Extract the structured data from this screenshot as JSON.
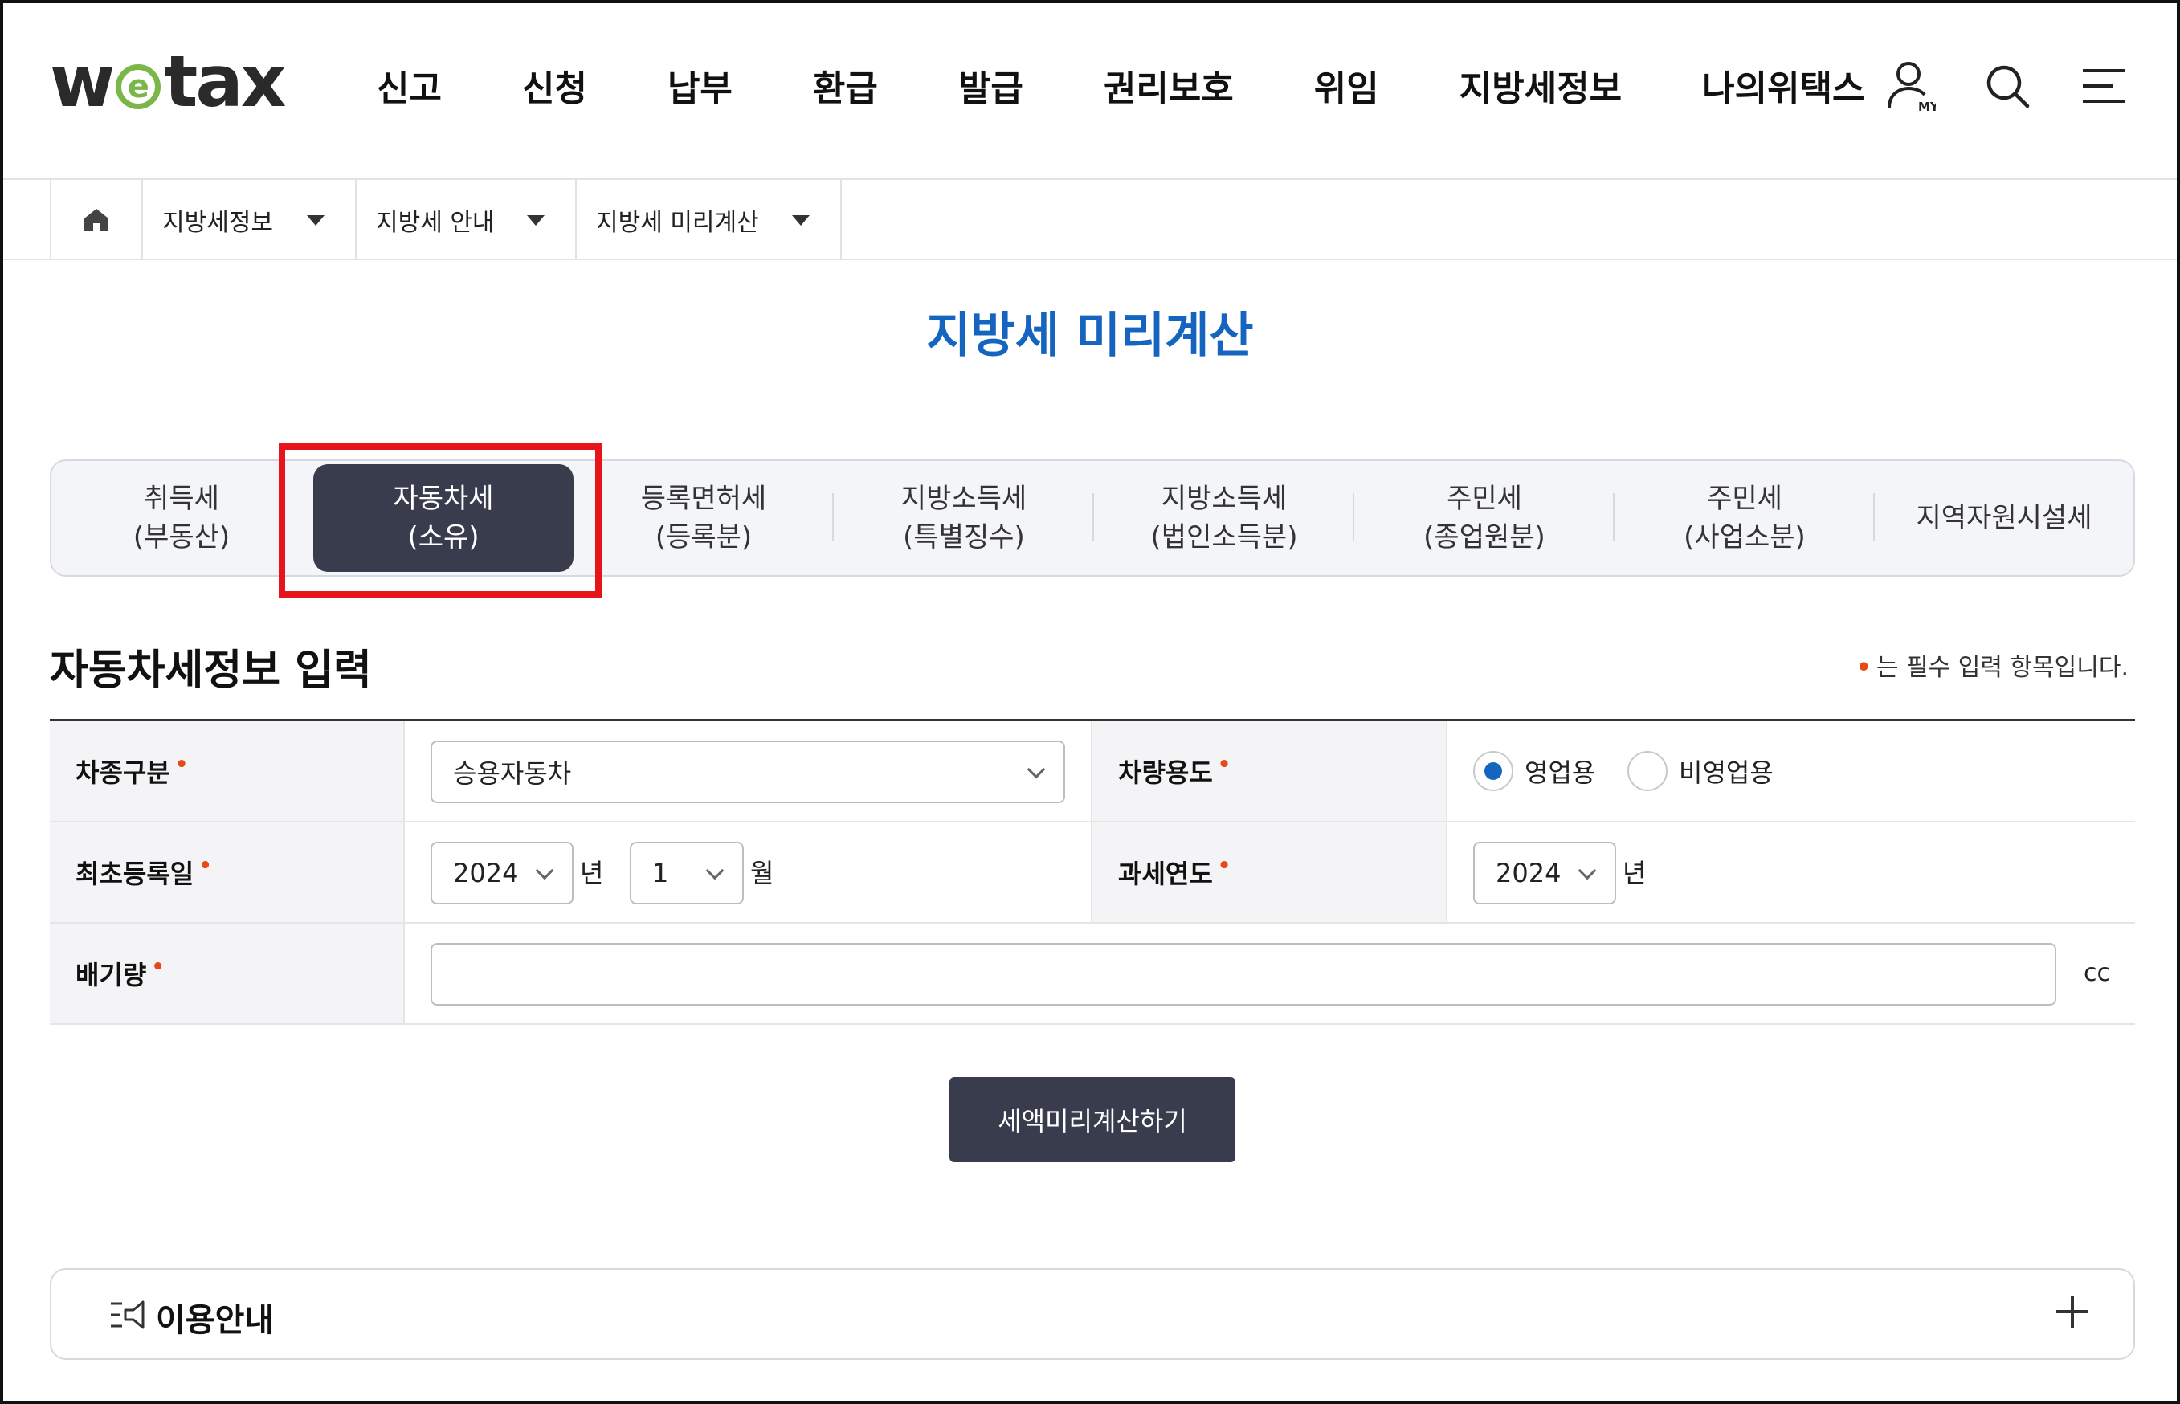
{
  "header": {
    "logo_pre": "w",
    "logo_e": "e",
    "logo_post": "tax",
    "nav": [
      "신고",
      "신청",
      "납부",
      "환급",
      "발급",
      "권리보호",
      "위임",
      "지방세정보",
      "나의위택스"
    ],
    "icons": [
      "my-user-icon",
      "search-icon",
      "menu-icon"
    ],
    "my_badge": "MY"
  },
  "breadcrumb": {
    "items": [
      "지방세정보",
      "지방세 안내",
      "지방세 미리계산"
    ]
  },
  "page": {
    "title": "지방세 미리계산"
  },
  "tabs": [
    {
      "label": "취득세\n(부동산)",
      "active": false
    },
    {
      "label": "자동차세\n(소유)",
      "active": true
    },
    {
      "label": "등록면허세\n(등록분)",
      "active": false
    },
    {
      "label": "지방소득세\n(특별징수)",
      "active": false
    },
    {
      "label": "지방소득세\n(법인소득분)",
      "active": false
    },
    {
      "label": "주민세\n(종업원분)",
      "active": false
    },
    {
      "label": "주민세\n(사업소분)",
      "active": false
    },
    {
      "label": "지역자원시설세",
      "active": false
    }
  ],
  "section": {
    "title": "자동차세정보 입력",
    "required_note": "는 필수 입력 항목입니다.",
    "required_mark": "•"
  },
  "form": {
    "vehicle_type": {
      "label": "차종구분",
      "value": "승용자동차"
    },
    "vehicle_use": {
      "label": "차량용도",
      "options": [
        "영업용",
        "비영업용"
      ],
      "selected": "영업용"
    },
    "first_registration": {
      "label": "최초등록일",
      "year": "2024",
      "year_unit": "년",
      "month": "1",
      "month_unit": "월"
    },
    "tax_year": {
      "label": "과세연도",
      "year": "2024",
      "year_unit": "년"
    },
    "displacement": {
      "label": "배기량",
      "value": "",
      "unit": "cc"
    }
  },
  "actions": {
    "calculate_label": "세액미리계산하기"
  },
  "guide": {
    "title": "이용안내"
  },
  "colors": {
    "accent_blue": "#1565c0",
    "dark_button": "#393c4c",
    "required_dot": "#e64a19",
    "highlight_red": "#e8141c",
    "logo_green": "#7ab648"
  }
}
